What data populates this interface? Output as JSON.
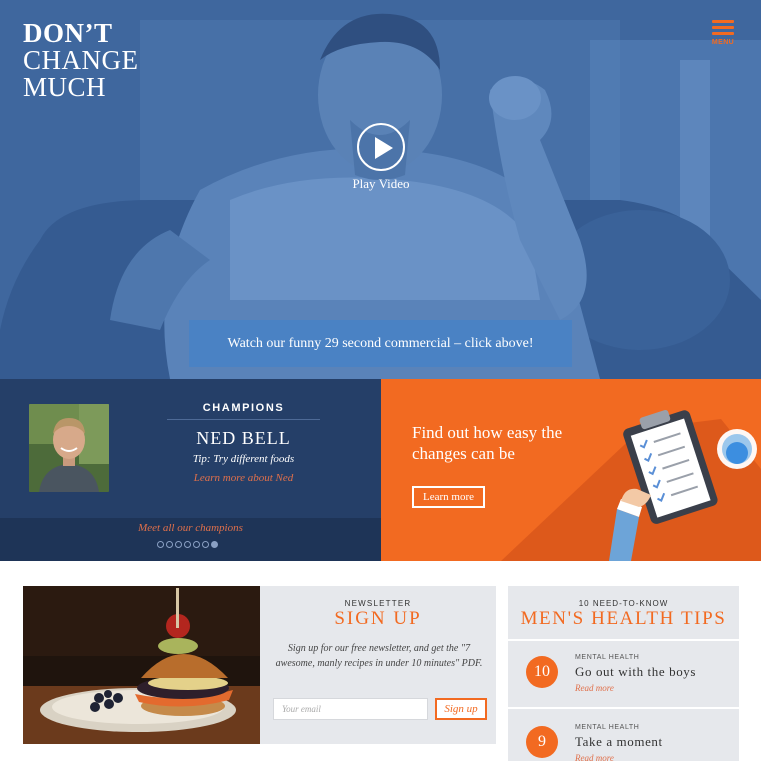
{
  "colors": {
    "hero_blue": "#3f679e",
    "navy": "#253f68",
    "navy_dark": "#1e3457",
    "orange": "#f26a21",
    "commercial_blue": "#4a82c4",
    "panel_gray": "#e6e8ec"
  },
  "logo": {
    "line1": "DON’T",
    "line2": "CHANGE",
    "line3": "MUCH"
  },
  "menu": {
    "label": "MENU",
    "icon": "hamburger-icon"
  },
  "hero": {
    "play_label": "Play Video",
    "play_icon": "play-icon",
    "commercial_text": "Watch our funny 29 second commercial – click above!"
  },
  "champions": {
    "heading": "CHAMPIONS",
    "name": "NED BELL",
    "tip": "Tip: Try different foods",
    "link": "Learn more about Ned",
    "all_link": "Meet all our champions",
    "dot_count": 7,
    "active_dot": 7
  },
  "promo": {
    "text": "Find out how easy the changes can be",
    "button": "Learn more",
    "icon": "clipboard-checklist-icon"
  },
  "newsletter": {
    "kicker": "NEWSLETTER",
    "title": "SIGN UP",
    "body": "Sign up for our free newsletter, and get the \"7 awesome, manly recipes in under 10 minutes\" PDF.",
    "email_placeholder": "Your email",
    "button": "Sign up"
  },
  "tips": {
    "kicker": "10 NEED-TO-KNOW",
    "title": "MEN'S HEALTH TIPS",
    "items": [
      {
        "number": "10",
        "category": "MENTAL HEALTH",
        "title": "Go out with the boys",
        "link": "Read more"
      },
      {
        "number": "9",
        "category": "MENTAL HEALTH",
        "title": "Take a moment",
        "link": "Read more"
      }
    ]
  }
}
